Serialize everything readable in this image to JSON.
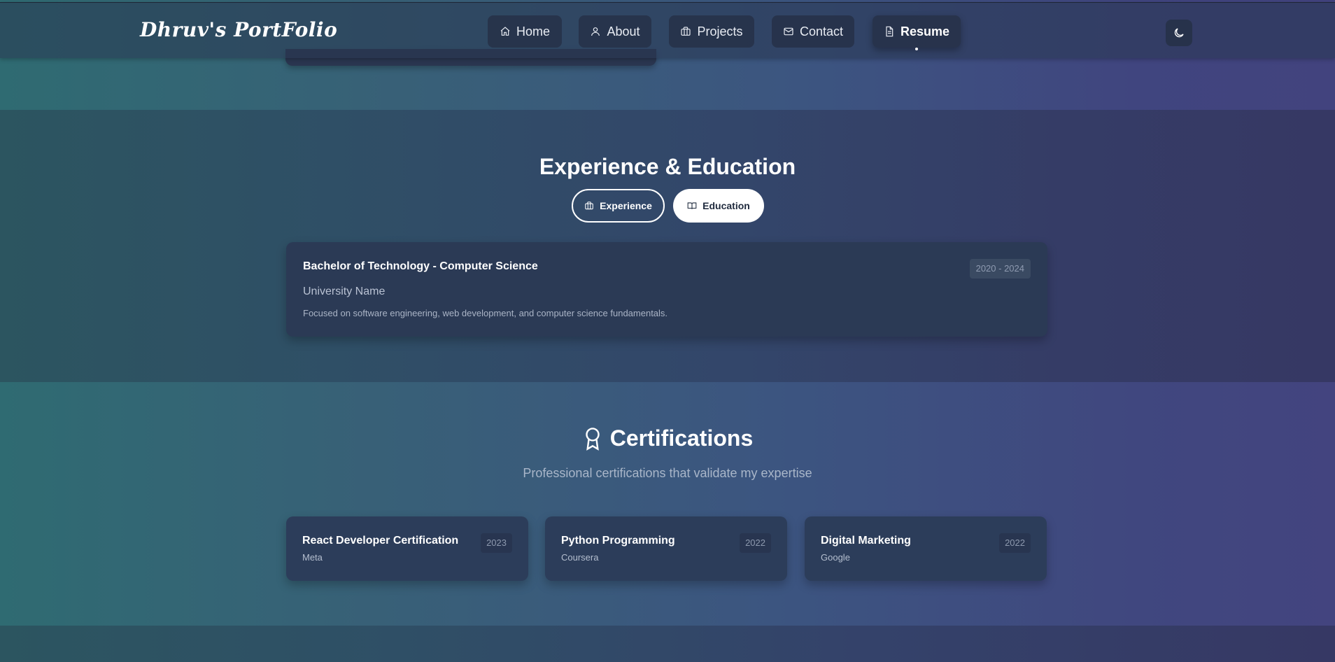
{
  "nav": {
    "logo": "Dhruv's PortFolio",
    "items": [
      {
        "label": "Home",
        "icon": "home-icon"
      },
      {
        "label": "About",
        "icon": "user-icon"
      },
      {
        "label": "Projects",
        "icon": "briefcase-icon"
      },
      {
        "label": "Contact",
        "icon": "mail-icon"
      },
      {
        "label": "Resume",
        "icon": "file-icon",
        "active": true
      }
    ],
    "theme_toggle_icon": "moon-icon"
  },
  "education_section": {
    "title": "Experience & Education",
    "tabs": [
      {
        "label": "Experience",
        "icon": "briefcase-icon"
      },
      {
        "label": "Education",
        "icon": "book-icon",
        "selected": true
      }
    ],
    "entries": [
      {
        "degree": "Bachelor of Technology - Computer Science",
        "school": "University Name",
        "description": "Focused on software engineering, web development, and computer science fundamentals.",
        "years": "2020 - 2024"
      }
    ]
  },
  "certifications": {
    "title": "Certifications",
    "icon": "award-icon",
    "subtitle": "Professional certifications that validate my expertise",
    "items": [
      {
        "name": "React Developer Certification",
        "issuer": "Meta",
        "year": "2023"
      },
      {
        "name": "Python Programming",
        "issuer": "Coursera",
        "year": "2022"
      },
      {
        "name": "Digital Marketing",
        "issuer": "Google",
        "year": "2022"
      }
    ]
  },
  "colors": {
    "card": "#2b3a55",
    "accent_text": "#ffffff",
    "muted_text": "#a9b6c9"
  }
}
